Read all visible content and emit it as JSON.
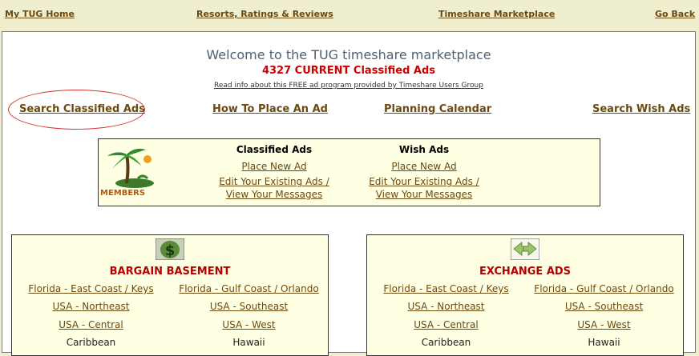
{
  "topnav": {
    "home": "My TUG Home",
    "resorts": "Resorts, Ratings & Reviews",
    "marketplace": "Timeshare Marketplace",
    "back": "Go Back"
  },
  "header": {
    "welcome": "Welcome to the TUG timeshare marketplace",
    "count": "4327 CURRENT Classified Ads",
    "readinfo": "Read info about this FREE ad program provided by Timeshare Users Group"
  },
  "nav": {
    "search_classified": "Search Classified Ads",
    "how_to_place": "How To Place An Ad",
    "planning_calendar": "Planning Calendar",
    "search_wish": "Search Wish Ads"
  },
  "members": {
    "logo_text": "MEMBERS",
    "classified": {
      "heading": "Classified Ads",
      "place_new": "Place New Ad",
      "edit_line1": "Edit Your Existing Ads /",
      "edit_line2": "View Your Messages"
    },
    "wish": {
      "heading": "Wish Ads",
      "place_new": "Place New Ad",
      "edit_line1": "Edit Your Existing Ads /",
      "edit_line2": "View Your Messages"
    }
  },
  "bargain": {
    "title": "BARGAIN BASEMENT",
    "icon": "dollar-icon",
    "items": [
      "Florida - East Coast / Keys",
      "Florida - Gulf Coast / Orlando",
      "USA - Northeast",
      "USA - Southeast",
      "USA - Central",
      "USA - West",
      "Caribbean",
      "Hawaii"
    ]
  },
  "exchange": {
    "title": "EXCHANGE ADS",
    "icon": "exchange-arrows-icon",
    "items": [
      "Florida - East Coast / Keys",
      "Florida - Gulf Coast / Orlando",
      "USA - Northeast",
      "USA - Southeast",
      "USA - Central",
      "USA - West",
      "Caribbean",
      "Hawaii"
    ]
  }
}
